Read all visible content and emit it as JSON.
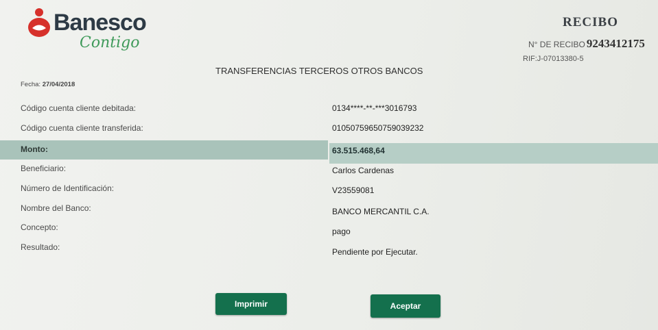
{
  "header": {
    "brand_name": "Banesco",
    "brand_tagline": "Contigo",
    "receipt_title": "RECIBO",
    "receipt_number_label": "N° DE RECIBO",
    "receipt_number": "9243412175",
    "rif": "RIF:J-07013380-5"
  },
  "section_title": "TRANSFERENCIAS TERCEROS OTROS BANCOS",
  "date": {
    "label": "Fecha:",
    "value": "27/04/2018"
  },
  "details": [
    {
      "label": "Código cuenta cliente debitada:",
      "value": "0134****-**-***3016793"
    },
    {
      "label": "Código cuenta cliente transferida:",
      "value": "01050759650759039232"
    },
    {
      "label": "Monto:",
      "value": "63.515.468,64"
    },
    {
      "label": "Beneficiario:",
      "value": "Carlos Cardenas"
    },
    {
      "label": "Número de Identificación:",
      "value": "V23559081"
    },
    {
      "label": "Nombre del Banco:",
      "value": "BANCO MERCANTIL C.A."
    },
    {
      "label": "Concepto:",
      "value": "pago"
    },
    {
      "label": "Resultado:",
      "value": "Pendiente por Ejecutar."
    }
  ],
  "buttons": {
    "print": "Imprimir",
    "accept": "Aceptar"
  },
  "colors": {
    "brand_red": "#d6312b",
    "brand_green": "#3f9a5a",
    "button_green": "#14704d",
    "highlight": "#a9c3ba"
  }
}
